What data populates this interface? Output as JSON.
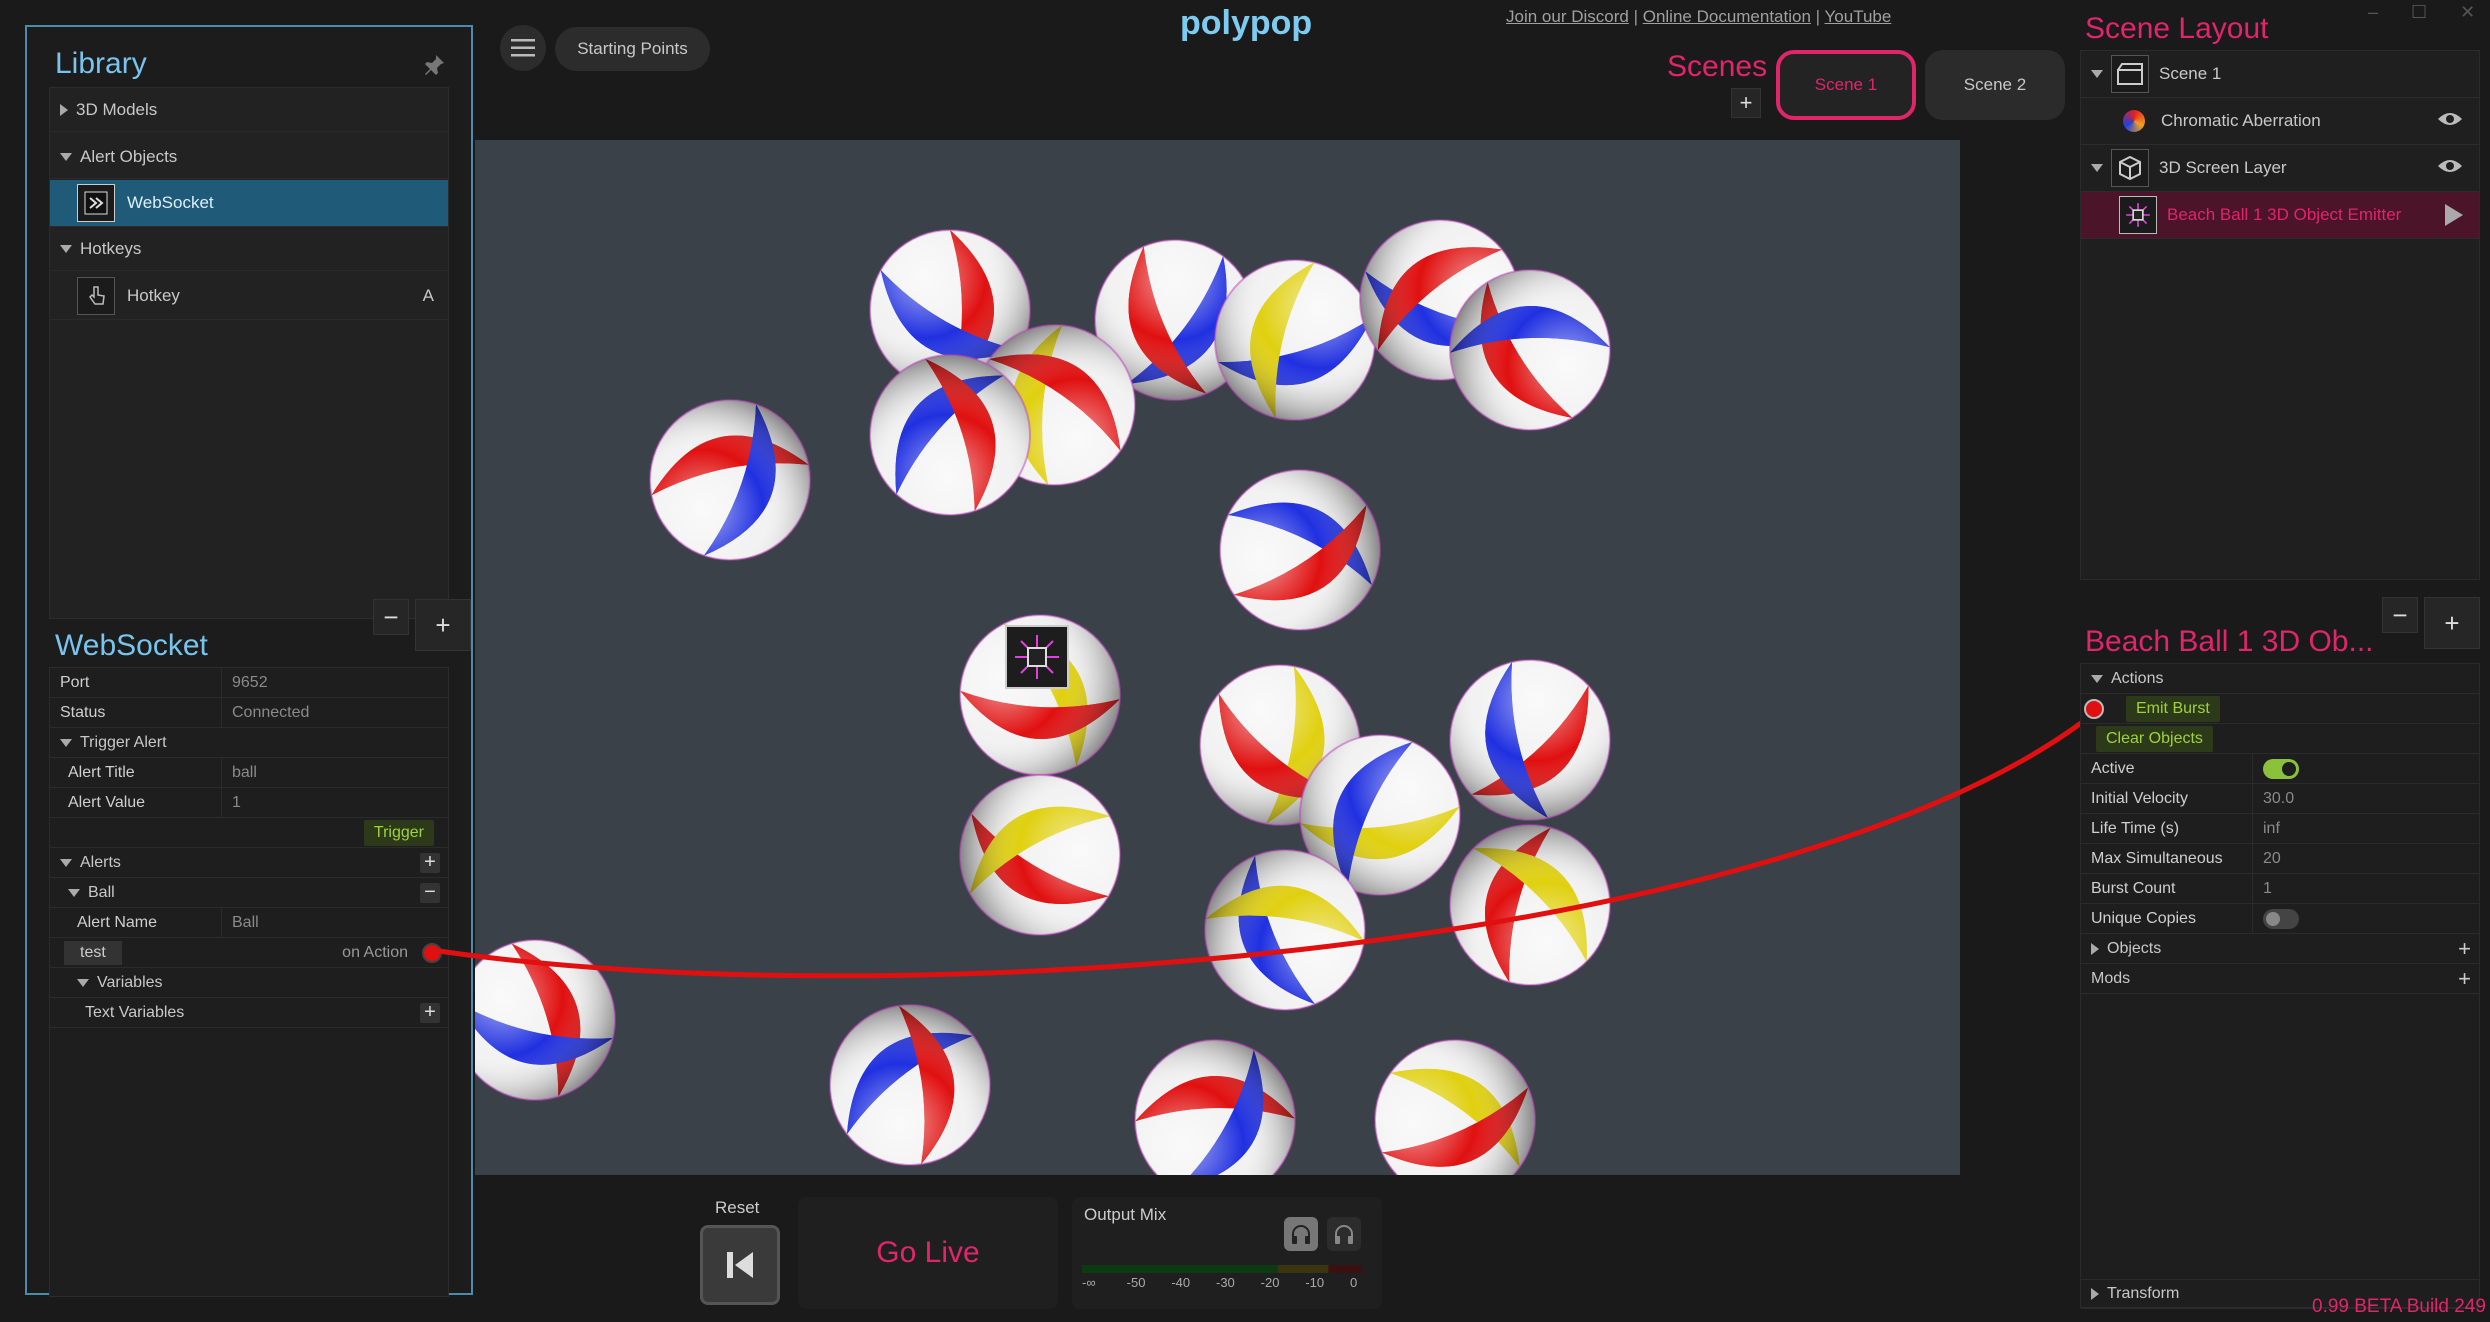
{
  "library": {
    "title": "Library",
    "categories": [
      {
        "label": "3D Models"
      },
      {
        "label": "Alert Objects"
      },
      {
        "label": "Hotkeys"
      }
    ],
    "items": {
      "websocket": "WebSocket",
      "hotkey": "Hotkey",
      "hotkey_key": "A"
    }
  },
  "websocket_panel": {
    "title": "WebSocket",
    "port_label": "Port",
    "port_value": "9652",
    "status_label": "Status",
    "status_value": "Connected",
    "trigger_alert_label": "Trigger Alert",
    "alert_title_label": "Alert Title",
    "alert_title_value": "ball",
    "alert_value_label": "Alert Value",
    "alert_value_value": "1",
    "trigger_button": "Trigger",
    "alerts_label": "Alerts",
    "ball_label": "Ball",
    "alert_name_label": "Alert Name",
    "alert_name_value": "Ball",
    "test_label": "test",
    "on_action_label": "on Action",
    "variables_label": "Variables",
    "text_variables_label": "Text Variables"
  },
  "topbar": {
    "starting_points": "Starting Points",
    "logo": "polypop",
    "link_discord": "Join our Discord",
    "link_docs": "Online Documentation",
    "link_youtube": "YouTube",
    "separator": "|"
  },
  "scenes": {
    "title": "Scenes",
    "scene1": "Scene 1",
    "scene2": "Scene 2"
  },
  "scene_layout": {
    "title": "Scene Layout",
    "rows": [
      "Scene 1",
      "Chromatic Aberration",
      "3D Screen Layer",
      "Beach Ball 1 3D Object Emitter"
    ]
  },
  "object_panel": {
    "title": "Beach Ball 1 3D Ob...",
    "actions_label": "Actions",
    "emit_burst": "Emit Burst",
    "clear_objects": "Clear Objects",
    "props": [
      {
        "k": "Active",
        "v": ""
      },
      {
        "k": "Initial Velocity",
        "v": "30.0"
      },
      {
        "k": "Life Time (s)",
        "v": "inf"
      },
      {
        "k": "Max Simultaneous",
        "v": "20"
      },
      {
        "k": "Burst Count",
        "v": "1"
      },
      {
        "k": "Unique Copies",
        "v": ""
      }
    ],
    "active_toggle": true,
    "unique_copies_toggle": false,
    "objects_label": "Objects",
    "mods_label": "Mods",
    "transform_label": "Transform"
  },
  "bottom": {
    "reset_label": "Reset",
    "go_live": "Go Live",
    "output_mix": "Output Mix",
    "meter_ticks": [
      "-∞",
      "-50",
      "-40",
      "-30",
      "-20",
      "-10",
      "0"
    ]
  },
  "build": "0.99 BETA Build 249",
  "colors": {
    "accent_blue": "#78c4ee",
    "accent_pink": "#e0256b",
    "wire_red": "#e01010",
    "toggle_green": "#8bc23a"
  }
}
